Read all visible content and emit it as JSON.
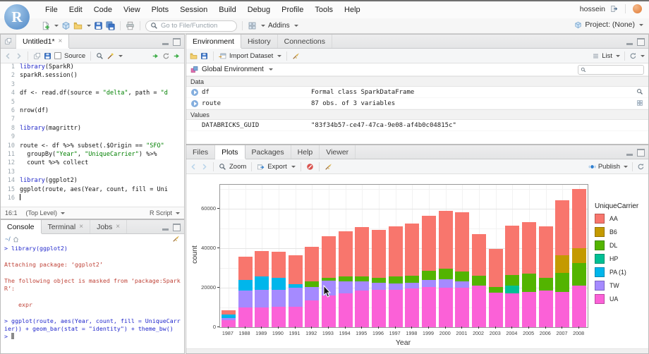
{
  "window": {
    "user": "hossein",
    "project": "Project: (None)"
  },
  "menu": {
    "items": [
      "File",
      "Edit",
      "Code",
      "View",
      "Plots",
      "Session",
      "Build",
      "Debug",
      "Profile",
      "Tools",
      "Help"
    ]
  },
  "main_toolbar": {
    "goto_placeholder": "Go to File/Function",
    "addins": "Addins"
  },
  "source_pane": {
    "tab": "Untitled1*",
    "toolbar": {
      "source_checkbox": "Source"
    },
    "code": [
      [
        [
          "k",
          "library"
        ],
        [
          "p",
          "(SparkR)"
        ]
      ],
      [
        [
          "p",
          "sparkR.session()"
        ]
      ],
      [],
      [
        [
          "p",
          "df <- read.df(source = "
        ],
        [
          "s",
          "\"delta\""
        ],
        [
          "p",
          ", path = "
        ],
        [
          "s",
          "\"d"
        ]
      ],
      [],
      [
        [
          "p",
          "nrow(df)"
        ]
      ],
      [],
      [
        [
          "k",
          "library"
        ],
        [
          "p",
          "(magrittr)"
        ]
      ],
      [],
      [
        [
          "p",
          "route <- df %>% subset(.$Origin == "
        ],
        [
          "s",
          "\"SFO\""
        ]
      ],
      [
        [
          "p",
          "  groupBy("
        ],
        [
          "s",
          "\"Year\""
        ],
        [
          "p",
          ", "
        ],
        [
          "s",
          "\"UniqueCarrier\""
        ],
        [
          "p",
          ") %>%"
        ]
      ],
      [
        [
          "p",
          "  count %>% collect"
        ]
      ],
      [],
      [
        [
          "k",
          "library"
        ],
        [
          "p",
          "(ggplot2)"
        ]
      ],
      [
        [
          "p",
          "ggplot(route, aes(Year, count, fill = Uni"
        ]
      ],
      [
        [
          "cursor",
          ""
        ]
      ]
    ],
    "status": {
      "position": "16:1",
      "scope": "(Top Level)",
      "type": "R Script"
    }
  },
  "console_pane": {
    "tabs": [
      {
        "label": "Console",
        "active": true,
        "closable": false
      },
      {
        "label": "Terminal",
        "active": false,
        "closable": true
      },
      {
        "label": "Jobs",
        "active": false,
        "closable": true
      }
    ],
    "path": "~/",
    "lines": [
      {
        "k": "cmd",
        "t": "> library(ggplot2)"
      },
      {
        "k": "blank",
        "t": ""
      },
      {
        "k": "msg",
        "t": "Attaching package: ‘ggplot2’"
      },
      {
        "k": "blank",
        "t": ""
      },
      {
        "k": "msg",
        "t": "The following object is masked from ‘package:SparkR’:"
      },
      {
        "k": "blank",
        "t": ""
      },
      {
        "k": "msg",
        "t": "    expr"
      },
      {
        "k": "blank",
        "t": ""
      },
      {
        "k": "cmd",
        "t": "> ggplot(route, aes(Year, count, fill = UniqueCarrier)) + geom_bar(stat = \"identity\") + theme_bw()"
      },
      {
        "k": "prompt",
        "t": "> "
      }
    ]
  },
  "environment_pane": {
    "tabs": [
      {
        "label": "Environment",
        "active": true
      },
      {
        "label": "History",
        "active": false
      },
      {
        "label": "Connections",
        "active": false
      }
    ],
    "toolbar": {
      "import": "Import Dataset",
      "view": "List"
    },
    "scope": "Global Environment",
    "sections": [
      {
        "header": "Data",
        "rows": [
          {
            "name": "df",
            "value": "Formal class SparkDataFrame",
            "expandable": true,
            "action": "magnifier"
          },
          {
            "name": "route",
            "value": "87 obs. of 3 variables",
            "expandable": true,
            "action": "table"
          }
        ]
      },
      {
        "header": "Values",
        "rows": [
          {
            "name": "DATABRICKS_GUID",
            "value": "\"83f34b57-ce47-47ca-9e08-af4b0c04815c\"",
            "expandable": false,
            "action": ""
          }
        ]
      }
    ]
  },
  "plots_pane": {
    "tabs": [
      {
        "label": "Files",
        "active": false
      },
      {
        "label": "Plots",
        "active": true
      },
      {
        "label": "Packages",
        "active": false
      },
      {
        "label": "Help",
        "active": false
      },
      {
        "label": "Viewer",
        "active": false
      }
    ],
    "toolbar": {
      "zoom": "Zoom",
      "export": "Export",
      "publish": "Publish"
    }
  },
  "chart_data": {
    "type": "bar",
    "stacked": true,
    "title": "",
    "xlabel": "Year",
    "ylabel": "count",
    "legend_title": "UniqueCarrier",
    "legend_position": "right",
    "grid": true,
    "ylim": [
      0,
      72000
    ],
    "yticks": [
      0,
      20000,
      40000,
      60000
    ],
    "categories": [
      "1987",
      "1988",
      "1989",
      "1990",
      "1991",
      "1992",
      "1993",
      "1994",
      "1995",
      "1996",
      "1997",
      "1998",
      "1999",
      "2000",
      "2001",
      "2002",
      "2003",
      "2004",
      "2005",
      "2006",
      "2007",
      "2008"
    ],
    "stack_bottom_to_top": [
      "UA",
      "TW",
      "PA (1)",
      "HP",
      "DL",
      "B6",
      "AA"
    ],
    "series": [
      {
        "name": "AA",
        "color": "#F8766D",
        "values": [
          2000,
          11500,
          13000,
          13200,
          14500,
          17500,
          21000,
          23000,
          25000,
          24500,
          25500,
          26500,
          28000,
          29500,
          30000,
          21000,
          19200,
          25000,
          26000,
          26000,
          27500,
          30000
        ]
      },
      {
        "name": "B6",
        "color": "#C49A00",
        "values": [
          0,
          0,
          0,
          0,
          0,
          0,
          0,
          0,
          0,
          0,
          0,
          0,
          0,
          0,
          0,
          0,
          0,
          0,
          0,
          0,
          9000,
          7500
        ]
      },
      {
        "name": "DL",
        "color": "#53B400",
        "values": [
          0,
          0,
          0,
          0,
          0,
          2800,
          1500,
          2500,
          2800,
          2500,
          3300,
          3500,
          4500,
          5300,
          5000,
          5000,
          2800,
          5500,
          9000,
          6500,
          9500,
          11500
        ]
      },
      {
        "name": "HP",
        "color": "#00C094",
        "values": [
          0,
          0,
          0,
          0,
          0,
          0,
          0,
          0,
          0,
          0,
          0,
          0,
          0,
          0,
          0,
          0,
          0,
          4000,
          0,
          0,
          0,
          0
        ]
      },
      {
        "name": "PA (1)",
        "color": "#00B6EB",
        "values": [
          2000,
          5500,
          6500,
          6000,
          1800,
          0,
          0,
          0,
          0,
          0,
          0,
          0,
          0,
          0,
          0,
          0,
          0,
          0,
          0,
          0,
          0,
          0
        ]
      },
      {
        "name": "TW",
        "color": "#A58AFF",
        "values": [
          1000,
          8500,
          9000,
          8800,
          9500,
          7000,
          7500,
          6000,
          4500,
          3500,
          3200,
          3000,
          3500,
          4200,
          3000,
          0,
          0,
          0,
          0,
          0,
          0,
          0
        ]
      },
      {
        "name": "UA",
        "color": "#FB61D7",
        "values": [
          3500,
          10000,
          10000,
          10200,
          10500,
          13500,
          16000,
          17000,
          18500,
          18800,
          19000,
          19500,
          20500,
          20000,
          20000,
          21000,
          17500,
          17000,
          18000,
          18500,
          18000,
          21000
        ]
      }
    ]
  }
}
